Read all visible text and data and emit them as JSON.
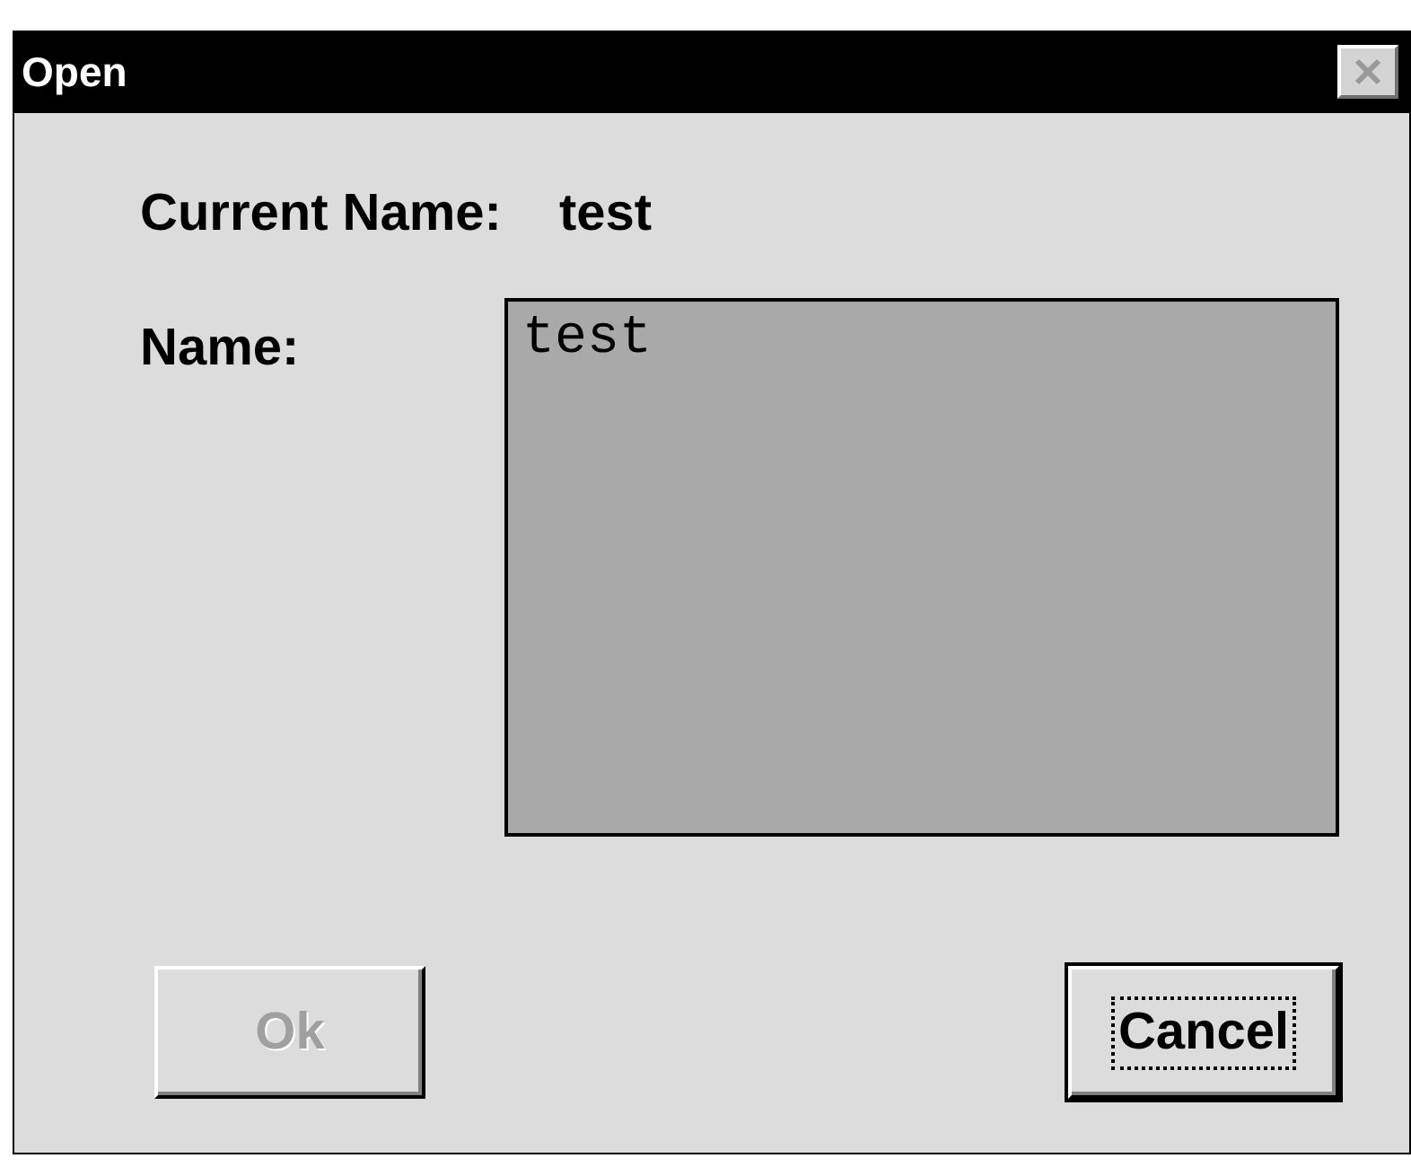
{
  "window": {
    "title": "Open",
    "close_disabled": true
  },
  "current_name": {
    "label": "Current Name:",
    "value": "test"
  },
  "name_field": {
    "label": "Name:",
    "value": "test"
  },
  "buttons": [
    {
      "label": "Ok",
      "disabled": true,
      "focused": false
    },
    {
      "label": "Cancel",
      "disabled": false,
      "focused": true
    }
  ]
}
